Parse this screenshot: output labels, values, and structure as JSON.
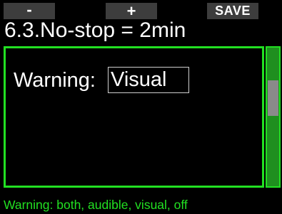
{
  "softkeys": {
    "left_label": "-",
    "middle_label": "+",
    "right_label": "SAVE"
  },
  "header": {
    "title": "6.3.No-stop = 2min"
  },
  "setting": {
    "label": "Warning:",
    "value": "Visual"
  },
  "footer": {
    "hint": "Warning: both, audible, visual, off"
  },
  "colors": {
    "accent": "#22e022",
    "softkey_bg": "#3d3d3d",
    "background": "#000000",
    "scroll_thumb": "#8a8a8a"
  }
}
